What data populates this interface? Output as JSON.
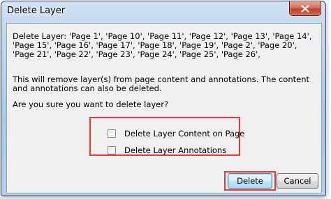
{
  "window": {
    "title": "Delete Layer"
  },
  "message": {
    "line1": "Delete Layer: 'Page 1', 'Page 10', 'Page 11', 'Page 12', 'Page 13', 'Page 14', 'Page 15', 'Page 16', 'Page 17', 'Page 18', 'Page 19', 'Page 2', 'Page 20', 'Page 21', 'Page 22', 'Page 23', 'Page 24', 'Page 25', 'Page 26',",
    "line2": "This will remove layer(s) from page content and annotations. The content and annotations can also be deleted.",
    "question": "Are you sure you want to delete layer?"
  },
  "options": {
    "delete_content_label": "Delete Layer Content on Page",
    "delete_content_checked": false,
    "delete_annotations_label": "Delete Layer Annotations",
    "delete_annotations_checked": false
  },
  "buttons": {
    "delete_label": "Delete",
    "cancel_label": "Cancel"
  },
  "colors": {
    "highlight": "#e8383d",
    "dialog_bg": "#f0f0f0",
    "frame": "#bcd3ea",
    "close_button": "#c2402a"
  },
  "icons": {
    "close": "close-icon"
  }
}
